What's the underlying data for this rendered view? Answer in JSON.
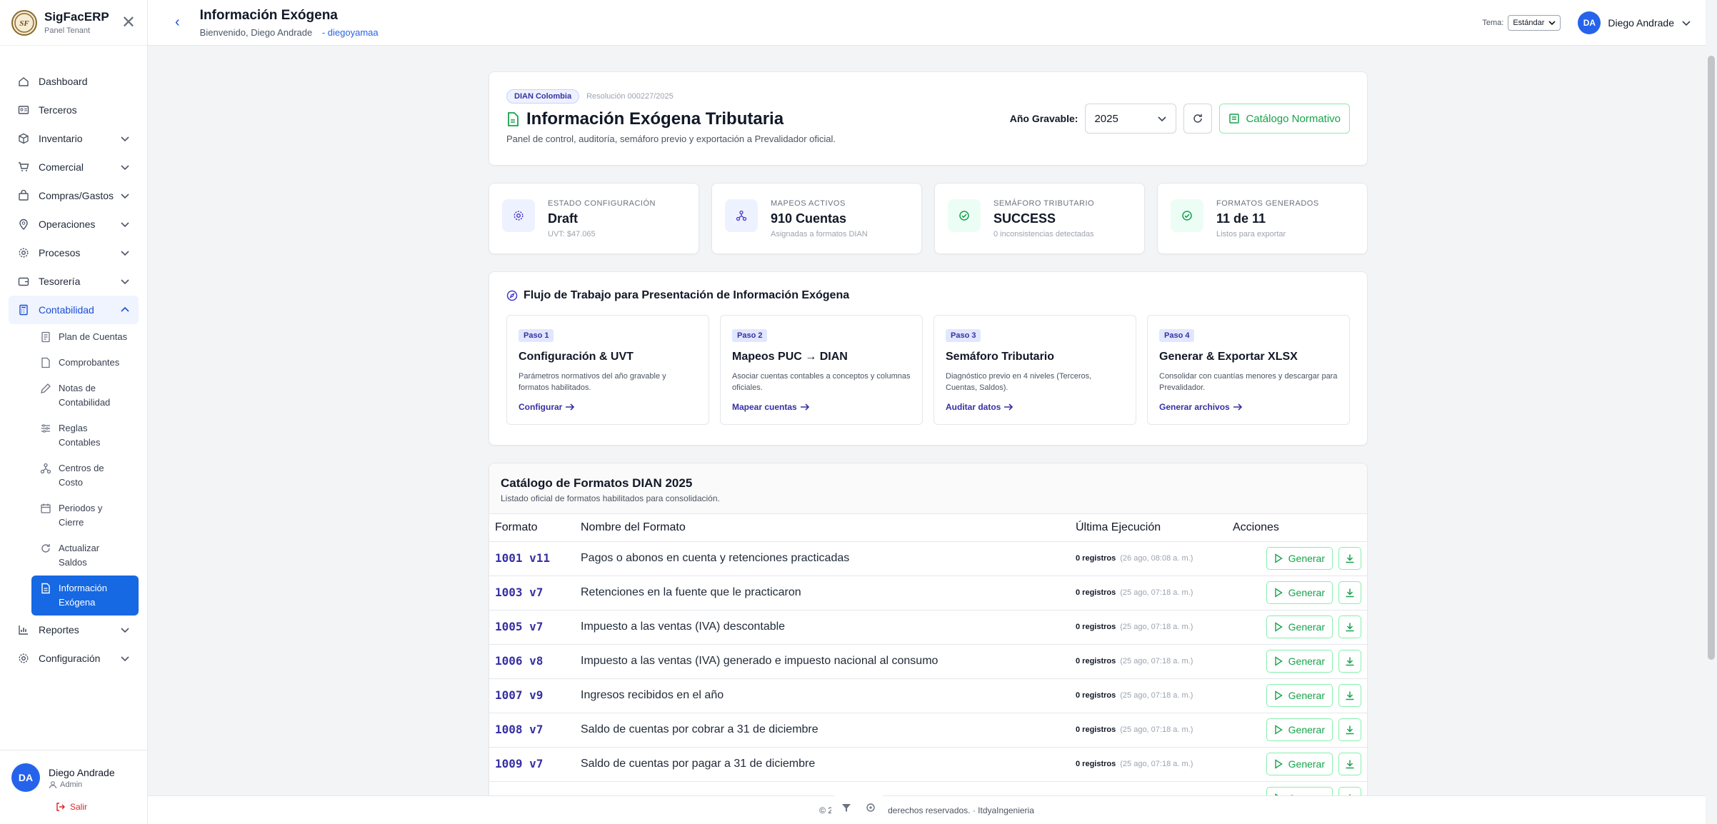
{
  "brand": {
    "name": "SigFacERP",
    "subtitle": "Panel Tenant",
    "logo_text": "SF"
  },
  "sidebar": {
    "items": [
      {
        "label": "Dashboard",
        "icon": "home-icon"
      },
      {
        "label": "Terceros",
        "icon": "id-card-icon"
      },
      {
        "label": "Inventario",
        "icon": "box-icon",
        "expandable": true
      },
      {
        "label": "Comercial",
        "icon": "cart-icon",
        "expandable": true
      },
      {
        "label": "Compras/Gastos",
        "icon": "bag-icon",
        "expandable": true
      },
      {
        "label": "Operaciones",
        "icon": "pin-icon",
        "expandable": true
      },
      {
        "label": "Procesos",
        "icon": "gear-icon",
        "expandable": true
      },
      {
        "label": "Tesorería",
        "icon": "wallet-icon",
        "expandable": true
      },
      {
        "label": "Contabilidad",
        "icon": "calculator-icon",
        "expandable": true,
        "expanded": true
      }
    ],
    "sub_items": [
      {
        "label": "Plan de Cuentas",
        "icon": "document-icon"
      },
      {
        "label": "Comprobantes",
        "icon": "receipt-icon"
      },
      {
        "label": "Notas de Contabilidad",
        "icon": "pencil-icon"
      },
      {
        "label": "Reglas Contables",
        "icon": "sliders-icon"
      },
      {
        "label": "Centros de Costo",
        "icon": "network-icon"
      },
      {
        "label": "Periodos y Cierre",
        "icon": "calendar-icon"
      },
      {
        "label": "Actualizar Saldos",
        "icon": "refresh-icon"
      },
      {
        "label": "Información Exógena",
        "icon": "file-icon",
        "active": true
      }
    ],
    "bottom_items": [
      {
        "label": "Reportes",
        "icon": "chart-icon",
        "expandable": true
      },
      {
        "label": "Configuración",
        "icon": "gear-icon",
        "expandable": true
      }
    ],
    "user": {
      "initials": "DA",
      "name": "Diego Andrade",
      "role": "Admin",
      "logout": "Salir"
    }
  },
  "topbar": {
    "title": "Información Exógena",
    "welcome": "Bienvenido, Diego Andrade",
    "handle": "- diegoyamaa",
    "theme_label": "Tema:",
    "theme_value": "Estándar",
    "user_initials": "DA",
    "user_name": "Diego Andrade"
  },
  "hero": {
    "badge": "DIAN Colombia",
    "resolution": "Resolución 000227/2025",
    "title": "Información Exógena Tributaria",
    "description": "Panel de control, auditoría, semáforo previo y exportación a Prevalidador oficial.",
    "year_label": "Año Gravable:",
    "year_value": "2025",
    "catalog_button": "Catálogo Normativo"
  },
  "stats": [
    {
      "label": "ESTADO CONFIGURACIÓN",
      "value": "Draft",
      "sub": "UVT: $47.065",
      "icon": "gear-icon",
      "bg": "#eef2ff",
      "fg": "#4338ca"
    },
    {
      "label": "MAPEOS ACTIVOS",
      "value": "910 Cuentas",
      "sub": "Asignadas a formatos DIAN",
      "icon": "network-icon",
      "bg": "#eef2ff",
      "fg": "#4338ca"
    },
    {
      "label": "SEMÁFORO TRIBUTARIO",
      "value": "SUCCESS",
      "sub": "0 inconsistencias detectadas",
      "icon": "check-circle-icon",
      "bg": "#ecfdf5",
      "fg": "#16a34a"
    },
    {
      "label": "FORMATOS GENERADOS",
      "value": "11 de 11",
      "sub": "Listos para exportar",
      "icon": "check-circle-icon",
      "bg": "#ecfdf5",
      "fg": "#16a34a"
    }
  ],
  "workflow": {
    "title": "Flujo de Trabajo para Presentación de Información Exógena",
    "steps": [
      {
        "badge": "Paso 1",
        "title": "Configuración & UVT",
        "desc": "Parámetros normativos del año gravable y formatos habilitados.",
        "link": "Configurar"
      },
      {
        "badge": "Paso 2",
        "title": "Mapeos PUC → DIAN",
        "desc": "Asociar cuentas contables a conceptos y columnas oficiales.",
        "link": "Mapear cuentas"
      },
      {
        "badge": "Paso 3",
        "title": "Semáforo Tributario",
        "desc": "Diagnóstico previo en 4 niveles (Terceros, Cuentas, Saldos).",
        "link": "Auditar datos"
      },
      {
        "badge": "Paso 4",
        "title": "Generar & Exportar XLSX",
        "desc": "Consolidar con cuantías menores y descargar para Prevalidador.",
        "link": "Generar archivos"
      }
    ]
  },
  "catalog": {
    "title": "Catálogo de Formatos DIAN 2025",
    "subtitle": "Listado oficial de formatos habilitados para consolidación.",
    "columns": [
      "Formato",
      "Nombre del Formato",
      "Última Ejecución",
      "Acciones"
    ],
    "generate_label": "Generar",
    "rows": [
      {
        "code": "1001 v11",
        "name": "Pagos o abonos en cuenta y retenciones practicadas",
        "records": "0 registros",
        "date": "(26 ago, 08:08 a. m.)"
      },
      {
        "code": "1003 v7",
        "name": "Retenciones en la fuente que le practicaron",
        "records": "0 registros",
        "date": "(25 ago, 07:18 a. m.)"
      },
      {
        "code": "1005 v7",
        "name": "Impuesto a las ventas (IVA) descontable",
        "records": "0 registros",
        "date": "(25 ago, 07:18 a. m.)"
      },
      {
        "code": "1006 v8",
        "name": "Impuesto a las ventas (IVA) generado e impuesto nacional al consumo",
        "records": "0 registros",
        "date": "(25 ago, 07:18 a. m.)"
      },
      {
        "code": "1007 v9",
        "name": "Ingresos recibidos en el año",
        "records": "0 registros",
        "date": "(25 ago, 07:18 a. m.)"
      },
      {
        "code": "1008 v7",
        "name": "Saldo de cuentas por cobrar a 31 de diciembre",
        "records": "0 registros",
        "date": "(25 ago, 07:18 a. m.)"
      },
      {
        "code": "1009 v7",
        "name": "Saldo de cuentas por pagar a 31 de diciembre",
        "records": "0 registros",
        "date": "(25 ago, 07:18 a. m.)"
      },
      {
        "code": "",
        "name": "",
        "records": "",
        "date": ""
      }
    ]
  },
  "footer": {
    "text": "© 2026 Todos los derechos reservados. · ItdyaIngenieria"
  }
}
